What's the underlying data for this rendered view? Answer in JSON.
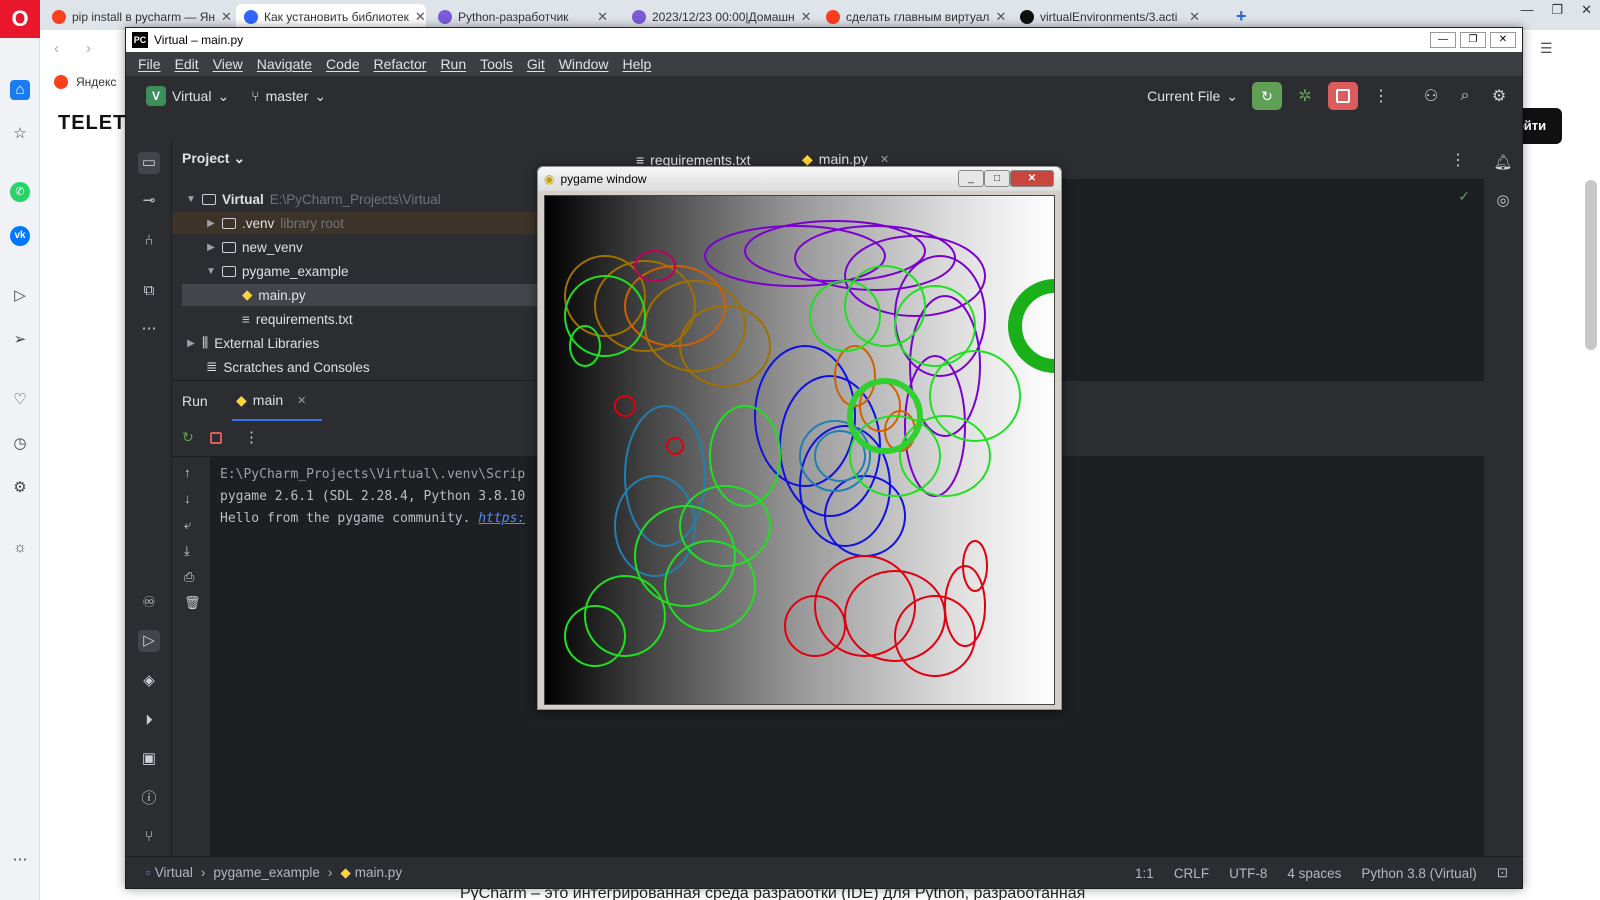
{
  "browser": {
    "tabs": [
      {
        "label": "pip install в pycharm — Ян",
        "color": "#fc3f1d"
      },
      {
        "label": "Как установить библиотек",
        "color": "#3366ff"
      },
      {
        "label": "Python-разработчик",
        "color": "#7b5cd6"
      },
      {
        "label": "2023/12/23 00:00|Домашн",
        "color": "#7b5cd6"
      },
      {
        "label": "сделать главным виртуал",
        "color": "#fc3f1d"
      },
      {
        "label": "virtualEnvironments/3.acti",
        "color": "#111111"
      }
    ],
    "new_tab": "+",
    "bookmark": "Яндекс",
    "site_logo": "ТЕLETYP",
    "login_button": "ойти",
    "page_text": "PyCharm – это интегрированная среда разработки (IDE) для Python, разработанная"
  },
  "ide": {
    "window_title": "Virtual – main.py",
    "menu": [
      "File",
      "Edit",
      "View",
      "Navigate",
      "Code",
      "Refactor",
      "Run",
      "Tools",
      "Git",
      "Window",
      "Help"
    ],
    "project_name": "Virtual",
    "project_badge": "V",
    "branch": "master",
    "run_config": "Current File",
    "project_header": "Project",
    "tree": {
      "root": "Virtual",
      "root_path": "E:\\PyCharm_Projects\\Virtual",
      "venv": ".venv",
      "venv_note": "library root",
      "new_venv": "new_venv",
      "pygame_example": "pygame_example",
      "main_py": "main.py",
      "requirements": "requirements.txt",
      "external_libs": "External Libraries",
      "scratches": "Scratches and Consoles"
    },
    "editor_tabs": [
      "requirements.txt",
      "main.py"
    ],
    "run_tab": "Run",
    "run_config_tab": "main",
    "console": {
      "line1": "E:\\PyCharm_Projects\\Virtual\\.venv\\Scrip",
      "line2": "pygame 2.6.1 (SDL 2.28.4, Python 3.8.10",
      "line3": "Hello from the pygame community. ",
      "line3_link": "https:"
    },
    "breadcrumb": [
      "Virtual",
      "pygame_example",
      "main.py"
    ],
    "status": {
      "position": "1:1",
      "line_sep": "CRLF",
      "encoding": "UTF-8",
      "indent": "4 spaces",
      "interpreter": "Python 3.8 (Virtual)"
    }
  },
  "pygame": {
    "title": "pygame window"
  },
  "colors": {
    "ide_bg": "#2b2d30",
    "accent": "#3574f0",
    "run_green": "#5f9f56",
    "stop_red": "#db5c5c"
  }
}
